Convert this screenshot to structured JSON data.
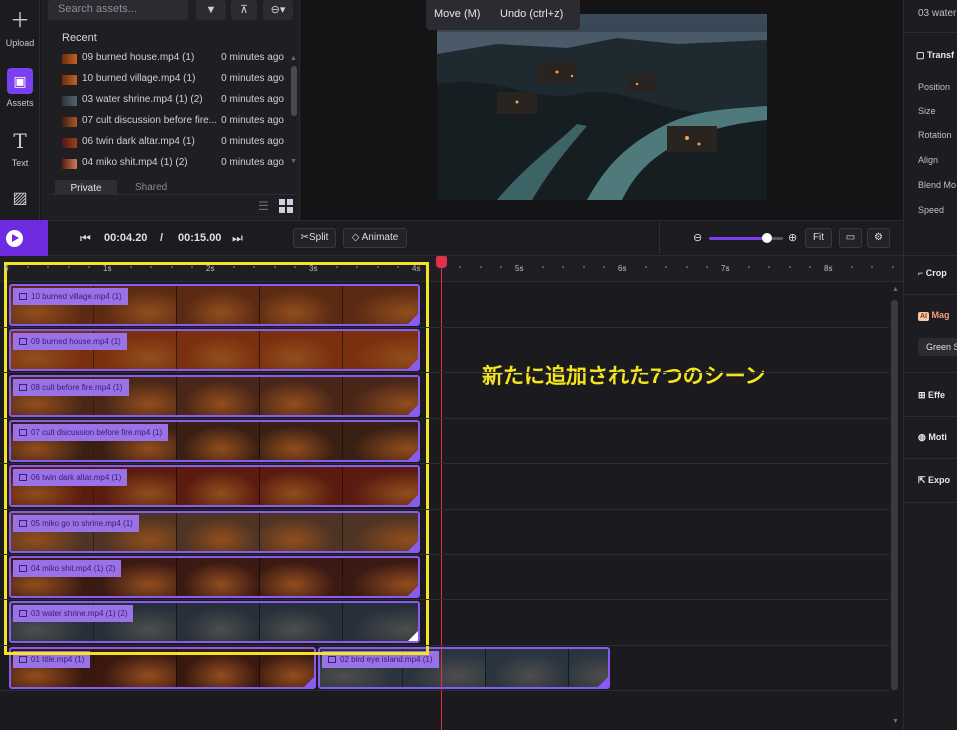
{
  "rail": {
    "upload_label": "Upload",
    "assets_label": "Assets",
    "text_label": "Text"
  },
  "assets": {
    "search_placeholder": "Search assets...",
    "recent_label": "Recent",
    "items": [
      {
        "name": "09 burned house.mp4 (1)",
        "time": "0 minutes ago"
      },
      {
        "name": "10 burned village.mp4 (1)",
        "time": "0 minutes ago"
      },
      {
        "name": "03 water shrine.mp4 (1) (2)",
        "time": "0 minutes ago"
      },
      {
        "name": "07 cult discussion before fire...",
        "time": "0 minutes ago"
      },
      {
        "name": "06 twin dark altar.mp4 (1)",
        "time": "0 minutes ago"
      },
      {
        "name": "04 miko shit.mp4 (1) (2)",
        "time": "0 minutes ago"
      }
    ],
    "tab_private": "Private",
    "tab_shared": "Shared"
  },
  "hints": {
    "move": "Move (M)",
    "undo": "Undo (ctrl+z)"
  },
  "properties": {
    "title": "03 water",
    "transform": "Transf",
    "position": "Position",
    "size": "Size",
    "rotation": "Rotation",
    "align": "Align",
    "blend": "Blend Mo",
    "speed": "Speed",
    "crop": "Crop",
    "magic": "Mag",
    "ai_badge": "AI",
    "green": "Green S",
    "effects": "Effe",
    "motion": "Moti",
    "export": "Expo"
  },
  "transport": {
    "current_time": "00:04.20",
    "separator": "/",
    "total_time": "00:15.00",
    "split_label": "Split",
    "animate_label": "Animate",
    "fit_label": "Fit",
    "zoom_level": 0.8
  },
  "ruler": [
    "0",
    "1s",
    "2s",
    "3s",
    "4s",
    "5s",
    "6s",
    "7s",
    "8s"
  ],
  "clips": [
    {
      "name": "10 burned village.mp4 (1)",
      "color": "#5a2a12"
    },
    {
      "name": "09 burned house.mp4 (1)",
      "color": "#7a2f0e"
    },
    {
      "name": "08 cult before fire.mp4 (1)",
      "color": "#4a2618"
    },
    {
      "name": "07 cult discussion before fire.mp4 (1)",
      "color": "#3a2014"
    },
    {
      "name": "06 twin dark altar.mp4 (1)",
      "color": "#5a1c10"
    },
    {
      "name": "05 miko go to shrine.mp4 (1)",
      "color": "#4e3424"
    },
    {
      "name": "04 miko shit.mp4 (1) (2)",
      "color": "#3c1a14"
    },
    {
      "name": "03 water shrine.mp4 (1) (2)",
      "color": "#27303a"
    },
    {
      "name": "01 title.mp4 (1)",
      "color": "#3a1810"
    },
    {
      "name": "02 bird eye island.mp4 (1)",
      "color": "#2a343e"
    }
  ],
  "annotation": "新たに追加された7つのシーン"
}
